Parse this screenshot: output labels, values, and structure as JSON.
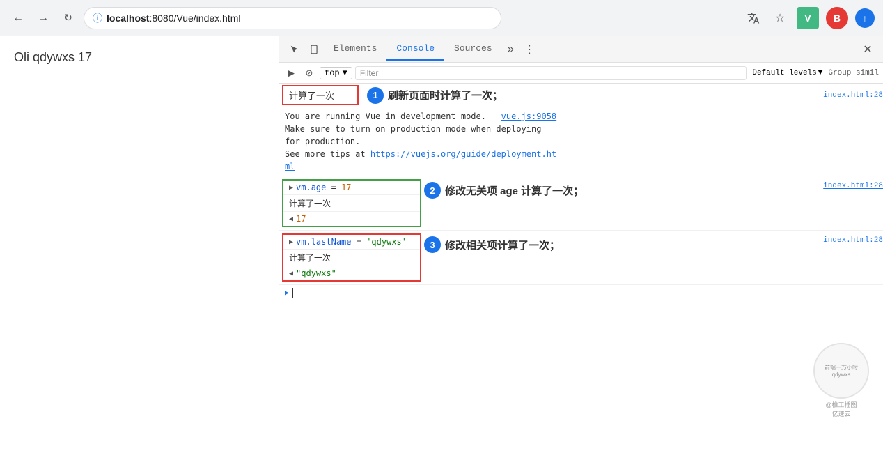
{
  "browser": {
    "url": "localhost:8080/Vue/index.html",
    "url_host": "localhost",
    "url_port_path": ":8080/Vue/index.html",
    "back_label": "←",
    "forward_label": "→",
    "reload_label": "↻",
    "translate_icon": "translate",
    "bookmark_icon": "☆",
    "menu_icon": "⋮",
    "profile_label": "B",
    "update_label": "↑"
  },
  "page": {
    "content": "Oli qdywxs 17"
  },
  "devtools": {
    "tabs": [
      {
        "label": "Elements",
        "active": false
      },
      {
        "label": "Console",
        "active": true
      },
      {
        "label": "Sources",
        "active": false
      }
    ],
    "more_tabs": "»",
    "menu_icon": "⋮",
    "close_icon": "✕",
    "cursor_icon": "↖",
    "device_icon": "▭",
    "toolbar": {
      "play_icon": "▶",
      "block_icon": "⊘",
      "context": "top",
      "dropdown": "▼",
      "filter_placeholder": "Filter",
      "levels_label": "Default levels",
      "levels_arrow": "▼",
      "group_label": "Group simil"
    },
    "console": {
      "entries": [
        {
          "id": "entry1",
          "type": "highlighted-red",
          "text": "计算了一次",
          "annotation_num": "1",
          "annotation_text": "刷新页面时计算了一次；",
          "source": "index.html:28"
        },
        {
          "id": "entry2",
          "type": "vue-warning",
          "lines": [
            "You are running Vue in development mode.   vue.js:9058",
            "Make sure to turn on production mode when deploying",
            "for production.",
            "See more tips at https://vuejs.org/guide/deployment.html"
          ],
          "link1": "vue.js:9058",
          "link2": "https://vuejs.org/guide/deployment.html"
        },
        {
          "id": "entry3",
          "type": "highlighted-green",
          "lines": [
            {
              "arrow": "▶",
              "text": "vm.age = 17"
            },
            {
              "text": "计算了一次"
            },
            {
              "arrow": "◀",
              "text": "17"
            }
          ],
          "annotation_num": "2",
          "annotation_text": "修改无关项 age 计算了一次；",
          "source": "index.html:28"
        },
        {
          "id": "entry4",
          "type": "highlighted-red-bottom",
          "lines": [
            {
              "arrow": "▶",
              "text": "vm.lastName = 'qdywxs'"
            },
            {
              "text": "计算了一次"
            },
            {
              "arrow": "◀",
              "text": "\"qdywxs\""
            }
          ],
          "annotation_num": "3",
          "annotation_text": "修改相关项计算了一次；",
          "source": "index.html:28"
        }
      ]
    }
  },
  "watermark": {
    "line1": "前端一万小时",
    "line2": "qdywxs",
    "line3": "@椎工插图",
    "line4": "亿速云"
  }
}
